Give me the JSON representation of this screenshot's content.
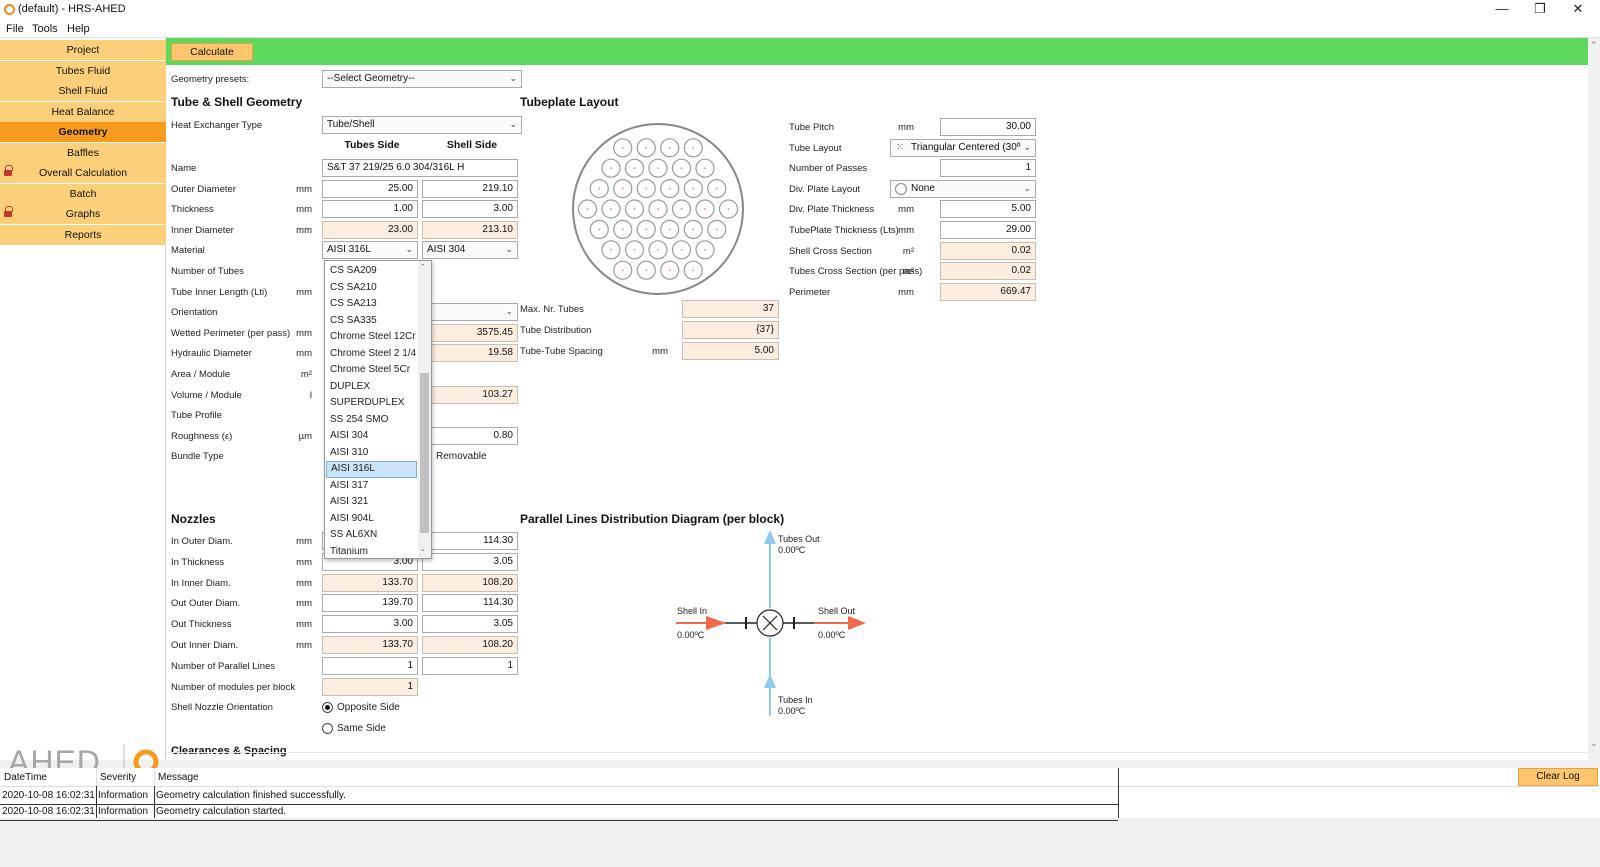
{
  "window": {
    "title": "(default) - HRS-AHED",
    "minimize": "—",
    "restore": "❐",
    "close": "✕"
  },
  "menu": [
    "File",
    "Tools",
    "Help"
  ],
  "sidebar": {
    "items": [
      {
        "label": "Project",
        "locked": false,
        "active": false
      },
      {
        "label": "Tubes Fluid",
        "locked": false,
        "active": false
      },
      {
        "label": "Shell Fluid",
        "locked": false,
        "active": false
      },
      {
        "label": "Heat Balance",
        "locked": false,
        "active": false
      },
      {
        "label": "Geometry",
        "locked": false,
        "active": true
      },
      {
        "label": "Baffles",
        "locked": false,
        "active": false
      },
      {
        "label": "Overall Calculation",
        "locked": true,
        "active": false
      },
      {
        "label": "Batch",
        "locked": false,
        "active": false
      },
      {
        "label": "Graphs",
        "locked": true,
        "active": false
      },
      {
        "label": "Reports",
        "locked": false,
        "active": false
      }
    ],
    "logo_text": "AHED"
  },
  "toolbar": {
    "calculate": "Calculate"
  },
  "presets": {
    "label": "Geometry presets:",
    "value": "--Select Geometry--"
  },
  "geometry": {
    "header": "Tube & Shell Geometry",
    "hx_type_label": "Heat Exchanger Type",
    "hx_type_value": "Tube/Shell",
    "col_tubes": "Tubes Side",
    "col_shell": "Shell Side",
    "rows": [
      {
        "label": "Name",
        "unit": "",
        "tube": "S&T 37 219/25 6.0 304/316L H",
        "shell": ""
      },
      {
        "label": "Outer Diameter",
        "unit": "mm",
        "tube": "25.00",
        "shell": "219.10"
      },
      {
        "label": "Thickness",
        "unit": "mm",
        "tube": "1.00",
        "shell": "3.00"
      },
      {
        "label": "Inner Diameter",
        "unit": "mm",
        "tube": "23.00",
        "shell": "213.10"
      },
      {
        "label": "Material",
        "unit": "",
        "tube": "AISI 316L",
        "shell": "AISI 304"
      },
      {
        "label": "Number of Tubes",
        "unit": "",
        "tube": "",
        "shell": ""
      },
      {
        "label": "Tube Inner Length (Lti)",
        "unit": "mm",
        "tube": "",
        "shell": ""
      },
      {
        "label": "Orientation",
        "unit": "",
        "tube": "",
        "shell": ""
      },
      {
        "label": "Wetted Perimeter (per pass)",
        "unit": "mm",
        "tube": "",
        "shell": "3575.45"
      },
      {
        "label": "Hydraulic Diameter",
        "unit": "mm",
        "tube": "",
        "shell": "19.58"
      },
      {
        "label": "Area / Module",
        "unit": "m²",
        "tube": "",
        "shell": ""
      },
      {
        "label": "Volume / Module",
        "unit": "l",
        "tube": "",
        "shell": "103.27"
      },
      {
        "label": "Tube Profile",
        "unit": "",
        "tube": "",
        "shell": ""
      },
      {
        "label": "Roughness (ε)",
        "unit": "µm",
        "tube": "",
        "shell": "0.80"
      },
      {
        "label": "Bundle Type",
        "unit": "",
        "tube": "",
        "shell": "Removable"
      }
    ]
  },
  "material_dropdown": {
    "options": [
      "CS SA209",
      "CS SA210",
      "CS SA213",
      "CS SA335",
      "Chrome Steel 12Cr",
      "Chrome Steel 2 1/4",
      "Chrome Steel 5Cr",
      "DUPLEX",
      "SUPERDUPLEX",
      "SS 254 SMO",
      "AISI 304",
      "AISI 310",
      "AISI 316L",
      "AISI 317",
      "AISI 321",
      "AISI 904L",
      "SS AL6XN",
      "Titanium"
    ],
    "selected": "AISI 316L"
  },
  "tubeplate": {
    "header": "Tubeplate Layout",
    "max_tubes_label": "Max. Nr. Tubes",
    "max_tubes": "37",
    "distribution_label": "Tube Distribution",
    "distribution": "{37}",
    "spacing_label": "Tube-Tube Spacing",
    "spacing_unit": "mm",
    "spacing": "5.00"
  },
  "right_params": [
    {
      "label": "Tube Pitch",
      "unit": "mm",
      "value": "30.00",
      "ro": false
    },
    {
      "label": "Tube Layout",
      "unit": "",
      "value": "Triangular Centered (30º",
      "ro": false
    },
    {
      "label": "Number of Passes",
      "unit": "",
      "value": "1",
      "ro": false
    },
    {
      "label": "Div. Plate Layout",
      "unit": "",
      "value": "None",
      "ro": false
    },
    {
      "label": "Div. Plate Thickness",
      "unit": "mm",
      "value": "5.00",
      "ro": false
    },
    {
      "label": "TubePlate Thickness (Lts)",
      "unit": "mm",
      "value": "29.00",
      "ro": false
    },
    {
      "label": "Shell Cross Section",
      "unit": "m²",
      "value": "0.02",
      "ro": true
    },
    {
      "label": "Tubes Cross Section (per pass)",
      "unit": "m²",
      "value": "0.02",
      "ro": true
    },
    {
      "label": "Perimeter",
      "unit": "mm",
      "value": "669.47",
      "ro": true
    }
  ],
  "nozzles": {
    "header": "Nozzles",
    "rows": [
      {
        "label": "In Outer Diam.",
        "unit": "mm",
        "tube": "",
        "shell": "114.30"
      },
      {
        "label": "In Thickness",
        "unit": "mm",
        "tube": "3.00",
        "shell": "3.05"
      },
      {
        "label": "In Inner Diam.",
        "unit": "mm",
        "tube": "133.70",
        "shell": "108.20"
      },
      {
        "label": "Out Outer Diam.",
        "unit": "mm",
        "tube": "139.70",
        "shell": "114.30"
      },
      {
        "label": "Out Thickness",
        "unit": "mm",
        "tube": "3.00",
        "shell": "3.05"
      },
      {
        "label": "Out Inner Diam.",
        "unit": "mm",
        "tube": "133.70",
        "shell": "108.20"
      },
      {
        "label": "Number of Parallel Lines",
        "unit": "",
        "tube": "1",
        "shell": "1"
      },
      {
        "label": "Number of modules per block",
        "unit": "",
        "tube": "1",
        "shell": ""
      }
    ],
    "orientation_label": "Shell Nozzle Orientation",
    "opt_opposite": "Opposite Side",
    "opt_same": "Same Side",
    "clearance_label": "Clearances & Spacing"
  },
  "diagram": {
    "header": "Parallel Lines Distribution Diagram (per block)",
    "tubes_out": "Tubes Out",
    "tubes_out_t": "0.00ºC",
    "tubes_in": "Tubes In",
    "tubes_in_t": "0.00ºC",
    "shell_in": "Shell In",
    "shell_in_t": "0.00ºC",
    "shell_out": "Shell Out",
    "shell_out_t": "0.00ºC"
  },
  "log": {
    "col_datetime": "DateTime",
    "col_severity": "Severity",
    "col_message": "Message",
    "clear": "Clear Log",
    "entries": [
      {
        "datetime": "2020-10-08 16:02:31",
        "severity": "Information",
        "message": "Geometry calculation finished successfully."
      },
      {
        "datetime": "2020-10-08 16:02:31",
        "severity": "Information",
        "message": "Geometry calculation started."
      }
    ]
  },
  "colors": {
    "accent": "#f79b1c",
    "nav": "#fcd07a",
    "green": "#5dd85d",
    "readonly": "#fbeee0",
    "arrow_red": "#ee6a4b",
    "arrow_blue": "#8ec8ea"
  }
}
